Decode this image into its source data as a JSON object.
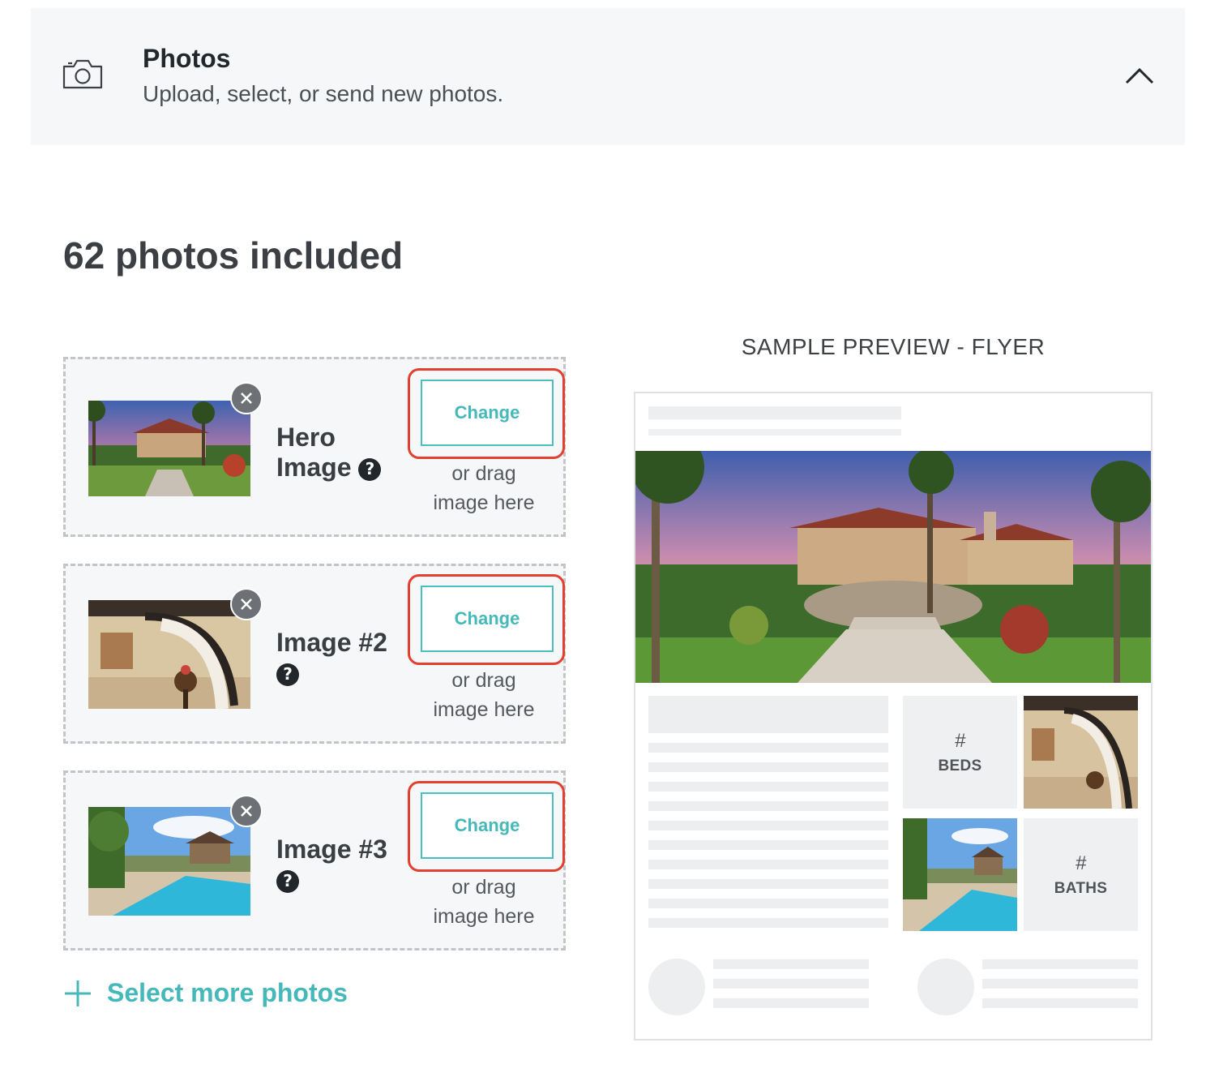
{
  "section": {
    "title": "Photos",
    "subtitle": "Upload, select, or send new photos.",
    "icon": "camera-icon",
    "collapse_icon": "chevron-up-icon"
  },
  "photo_count_label": "62 photos included",
  "slots": [
    {
      "label_line1": "Hero",
      "label_line2": "Image",
      "change_label": "Change",
      "drag_line1": "or drag",
      "drag_line2": "image here",
      "thumb": "house-exterior-photo"
    },
    {
      "label_line1": "Image #2",
      "label_line2": "",
      "change_label": "Change",
      "drag_line1": "or drag",
      "drag_line2": "image here",
      "thumb": "staircase-interior-photo"
    },
    {
      "label_line1": "Image #3",
      "label_line2": "",
      "change_label": "Change",
      "drag_line1": "or drag",
      "drag_line2": "image here",
      "thumb": "pool-backyard-photo"
    }
  ],
  "help_glyph": "?",
  "select_more_label": "Select more photos",
  "preview": {
    "title": "SAMPLE PREVIEW - FLYER",
    "beds_hash": "#",
    "beds_label": "BEDS",
    "baths_hash": "#",
    "baths_label": "BATHS"
  },
  "colors": {
    "accent": "#45b8b9",
    "highlight": "#e4402f",
    "panel_bg": "#f6f7f9"
  }
}
